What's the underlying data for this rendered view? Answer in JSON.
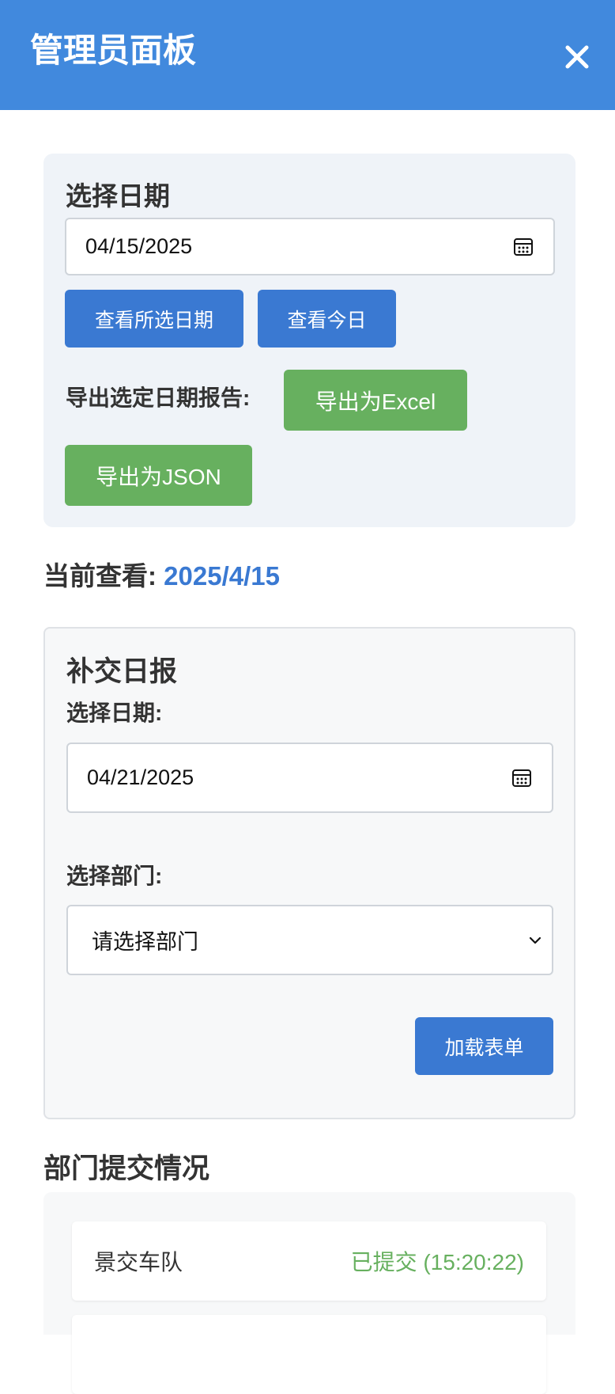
{
  "header": {
    "title": "管理员面板",
    "close_icon": "close-icon"
  },
  "date_panel": {
    "label": "选择日期",
    "date_value": "04/15/2025",
    "view_selected_button": "查看所选日期",
    "view_today_button": "查看今日",
    "export_label": "导出选定日期报告:",
    "export_excel_button": "导出为Excel",
    "export_json_button": "导出为JSON"
  },
  "current_view": {
    "label": "当前查看: ",
    "date": "2025/4/15"
  },
  "makeup_report": {
    "title": "补交日报",
    "date_label": "选择日期:",
    "date_value": "04/21/2025",
    "department_label": "选择部门:",
    "department_placeholder": "请选择部门",
    "load_button": "加载表单"
  },
  "submission": {
    "title": "部门提交情况",
    "departments": [
      {
        "name": "景交车队",
        "status": "已提交 (15:20:22)"
      }
    ]
  },
  "colors": {
    "header_bg": "#4189dd",
    "primary_button": "#3a79d2",
    "success_button": "#67b05f",
    "status_submitted": "#67b05f"
  }
}
